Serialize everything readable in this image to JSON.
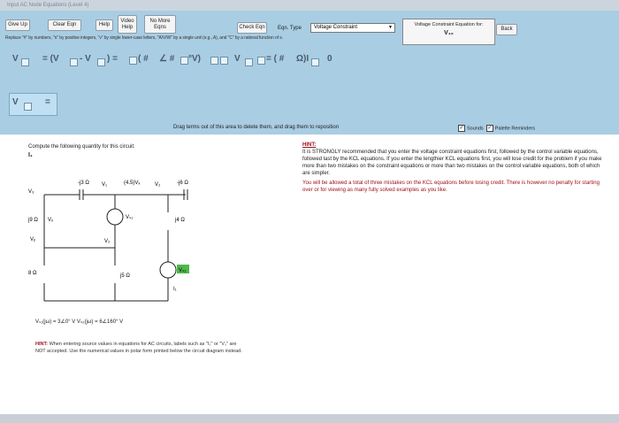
{
  "window": {
    "title": "Input AC Node Equations (Level 4)"
  },
  "toolbar": {
    "give_up": "Give Up",
    "clear_eqn": "Clear Eqn",
    "help": "Help",
    "video_help": "Video Help",
    "no_more_eqns": "No More Eqns",
    "check_eqn": "Check Eqn",
    "eqn_type_label": "Eqn. Type",
    "eqn_type_value": "Voltage Constraint",
    "back": "Back"
  },
  "instructions": "Replace \"#\" by numbers, \"n\" by positive integers, \"v\" by single lower-case letters, \"A/V/W\" by a single unit (e.g., A), and \"C\" by a rational function of s.",
  "constraint_box": {
    "title": "Voltage Constraint Equation for:",
    "var": "V₁₂"
  },
  "equation_tokens": [
    "V",
    "= (V",
    "- V",
    ") =",
    "( #",
    "∠ #",
    "°V)",
    "V",
    "= ( #",
    "Ω)I",
    "0"
  ],
  "row2_tokens": [
    "V",
    "="
  ],
  "drag_message": "Drag terms out of this area to delete them, and drag them to reposition",
  "options": {
    "sounds": "Sounds",
    "palette": "Palette Reminders"
  },
  "problem": {
    "prompt": "Compute the following quantity for this circuit:",
    "quantity": "I₁"
  },
  "circuit_labels": {
    "cap": "-j3 Ω",
    "v1": "V₁",
    "dep": "(4.5)Vₓ",
    "v2": "V₂",
    "cap2": "-j6 Ω",
    "v3": "V₃",
    "ind9": "j9 Ω",
    "vx": "Vₓ",
    "vs1": "Vₛ₁",
    "ind4": "j4 Ω",
    "vy": "Vᵧ",
    "vz": "V₂",
    "r8": "8 Ω",
    "r5": "j5 Ω",
    "vs2": "Vₛ₂",
    "i1": "I₁"
  },
  "sources": "Vₛ₁(jω) = 3∠0° V    Vₛ₂(jω) = 6∠160° V",
  "hint_left": {
    "label": "HINT:",
    "text": "When entering source values in equations for AC circuits, labels such as \"Iₛ\" or \"Vₛ\" are NOT accepted. Use the numerical values in polar form printed below the circuit diagram instead."
  },
  "hint_right": {
    "label": "HINT:",
    "p1": "It is STRONGLY recommended that you enter the voltage constraint equations first, followed by the control variable equations, followed last by the KCL equations. If you enter the lengthier KCL equations first, you will lose credit for the problem if you make more than two mistakes on the constraint equations or more than two mistakes on the control variable equations, both of which are simpler.",
    "p2": "You will be allowed a total of three mistakes on the KCL equations before losing credit. There is however no penalty for starting over or for viewing as many fully solved examples as you like."
  }
}
